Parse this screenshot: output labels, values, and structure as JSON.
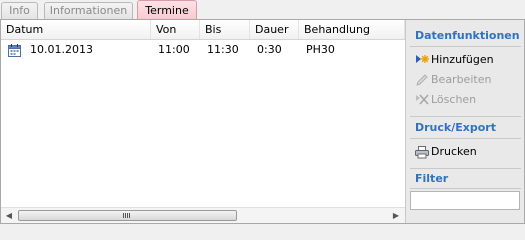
{
  "tabs": [
    {
      "label": "Info"
    },
    {
      "label": "Informationen"
    },
    {
      "label": "Termine"
    }
  ],
  "grid": {
    "columns": [
      "Datum",
      "Von",
      "Bis",
      "Dauer",
      "Behandlung"
    ],
    "rows": [
      {
        "datum": "10.01.2013",
        "von": "11:00",
        "bis": "11:30",
        "dauer": "0:30",
        "behandlung": "PH30"
      }
    ]
  },
  "panel": {
    "datenfunktionen_title": "Datenfunktionen",
    "hinzufuegen": "Hinzufügen",
    "bearbeiten": "Bearbeiten",
    "loeschen": "Löschen",
    "druck_title": "Druck/Export",
    "drucken": "Drucken",
    "filter_title": "Filter",
    "filter_value": ""
  },
  "colors": {
    "accent": "#2f72c2",
    "active_tab": "#f8c9d0",
    "disabled": "#9d9d9d"
  }
}
